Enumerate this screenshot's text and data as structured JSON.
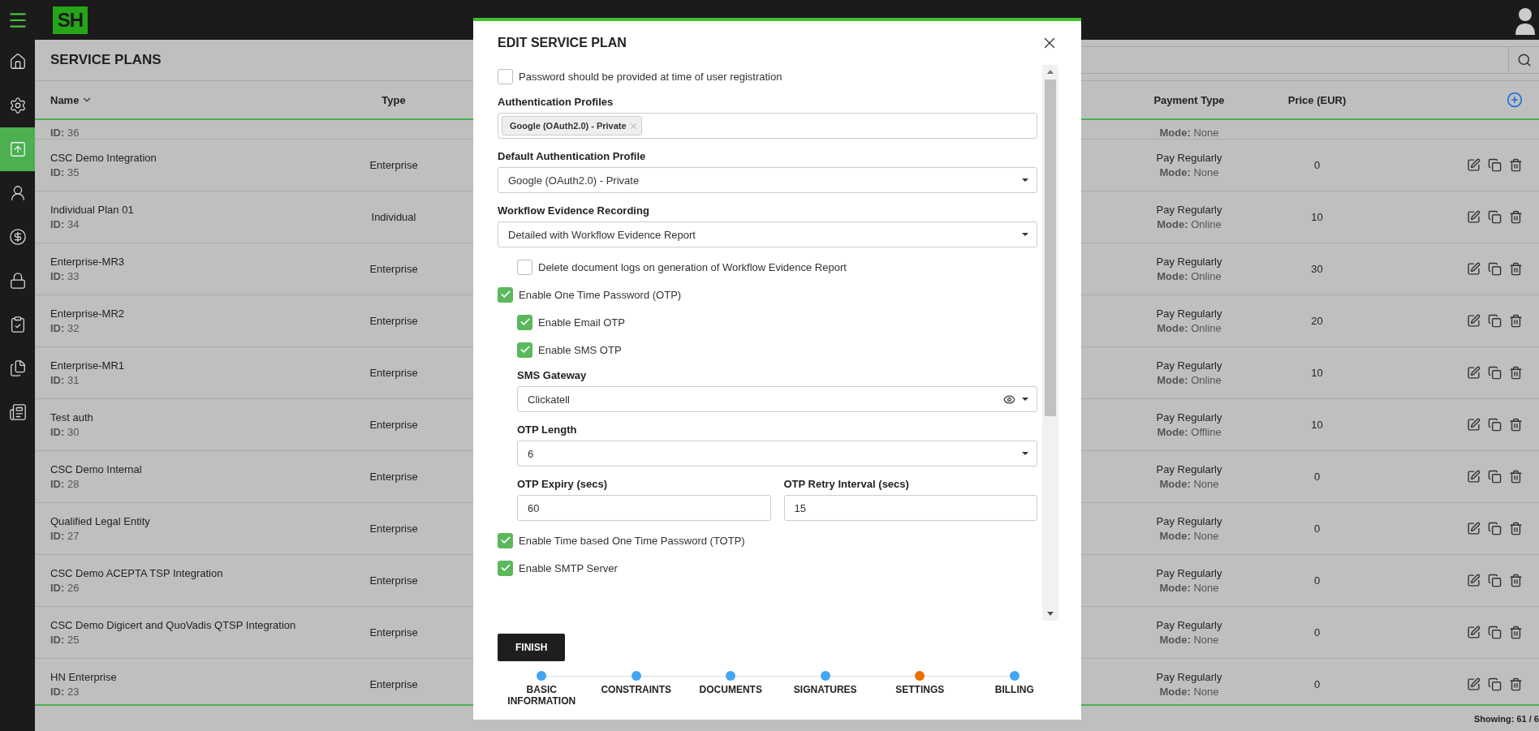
{
  "topbar": {
    "logo": "SH"
  },
  "sidebar": {
    "items": [
      {
        "selected": false
      },
      {
        "selected": false
      },
      {
        "selected": true
      },
      {
        "selected": false
      },
      {
        "selected": false
      },
      {
        "selected": false
      },
      {
        "selected": false
      },
      {
        "selected": false
      },
      {
        "selected": false
      }
    ]
  },
  "page": {
    "title": "SERVICE PLANS"
  },
  "table": {
    "columns": [
      {
        "label": "Name",
        "sorted": true
      },
      {
        "label": "Type",
        "sorted": false
      },
      {
        "label": "Payment Type",
        "sorted": false
      },
      {
        "label": "Price (EUR)",
        "sorted": false
      }
    ],
    "rows": [
      {
        "kind": "partial",
        "id_label": "ID:",
        "id": "36",
        "mode_label": "Mode:",
        "mode": "None"
      },
      {
        "kind": "full",
        "name": "CSC Demo Integration",
        "id_label": "ID:",
        "id": "35",
        "mode_label": "Mode:",
        "type": "Enterprise",
        "payment": "Pay Regularly",
        "mode": "None",
        "price": "0"
      },
      {
        "kind": "full",
        "name": "Individual Plan 01",
        "id_label": "ID:",
        "id": "34",
        "mode_label": "Mode:",
        "type": "Individual",
        "payment": "Pay Regularly",
        "mode": "Online",
        "price": "10"
      },
      {
        "kind": "full",
        "name": "Enterprise-MR3",
        "id_label": "ID:",
        "id": "33",
        "mode_label": "Mode:",
        "type": "Enterprise",
        "payment": "Pay Regularly",
        "mode": "Online",
        "price": "30"
      },
      {
        "kind": "full",
        "name": "Enterprise-MR2",
        "id_label": "ID:",
        "id": "32",
        "mode_label": "Mode:",
        "type": "Enterprise",
        "payment": "Pay Regularly",
        "mode": "Online",
        "price": "20"
      },
      {
        "kind": "full",
        "name": "Enterprise-MR1",
        "id_label": "ID:",
        "id": "31",
        "mode_label": "Mode:",
        "type": "Enterprise",
        "payment": "Pay Regularly",
        "mode": "Online",
        "price": "10"
      },
      {
        "kind": "full",
        "name": "Test auth",
        "id_label": "ID:",
        "id": "30",
        "mode_label": "Mode:",
        "type": "Enterprise",
        "payment": "Pay Regularly",
        "mode": "Offline",
        "price": "10"
      },
      {
        "kind": "full",
        "name": "CSC Demo Internal",
        "id_label": "ID:",
        "id": "28",
        "mode_label": "Mode:",
        "type": "Enterprise",
        "payment": "Pay Regularly",
        "mode": "None",
        "price": "0"
      },
      {
        "kind": "full",
        "name": "Qualified Legal Entity",
        "id_label": "ID:",
        "id": "27",
        "mode_label": "Mode:",
        "type": "Enterprise",
        "payment": "Pay Regularly",
        "mode": "None",
        "price": "0"
      },
      {
        "kind": "full",
        "name": "CSC Demo ACEPTA TSP Integration",
        "id_label": "ID:",
        "id": "26",
        "mode_label": "Mode:",
        "type": "Enterprise",
        "payment": "Pay Regularly",
        "mode": "None",
        "price": "0"
      },
      {
        "kind": "full",
        "name": "CSC Demo Digicert and QuoVadis QTSP Integration",
        "id_label": "ID:",
        "id": "25",
        "mode_label": "Mode:",
        "type": "Enterprise",
        "payment": "Pay Regularly",
        "mode": "None",
        "price": "0"
      },
      {
        "kind": "full",
        "name": "HN Enterprise",
        "id_label": "ID:",
        "id": "23",
        "mode_label": "Mode:",
        "type": "Enterprise",
        "payment": "Pay Regularly",
        "mode": "None",
        "price": "0"
      }
    ]
  },
  "footer": {
    "showing": "Showing: 61 / 6"
  },
  "modal": {
    "title": "EDIT SERVICE PLAN",
    "form": [
      {
        "kind": "checkbox",
        "label": "Password should be provided at time of user registration",
        "checked": false
      },
      {
        "kind": "multiselect",
        "label": "Authentication Profiles",
        "chips": [
          "Google (OAuth2.0) - Private"
        ]
      },
      {
        "kind": "select",
        "label": "Default Authentication Profile",
        "value": "Google (OAuth2.0) - Private"
      },
      {
        "kind": "select",
        "label": "Workflow Evidence Recording",
        "value": "Detailed with Workflow Evidence Report",
        "children": [
          {
            "kind": "checkbox",
            "label": "Delete document logs on generation of Workflow Evidence Report",
            "checked": false
          }
        ]
      },
      {
        "kind": "checkbox",
        "label": "Enable One Time Password (OTP)",
        "checked": true,
        "children": [
          {
            "kind": "checkbox",
            "label": "Enable Email OTP",
            "checked": true
          },
          {
            "kind": "checkbox",
            "label": "Enable SMS OTP",
            "checked": true
          },
          {
            "kind": "select",
            "label": "SMS Gateway",
            "value": "Clickatell",
            "reveal": true
          },
          {
            "kind": "select",
            "label": "OTP Length",
            "value": "6"
          },
          {
            "kind": "pair",
            "fields": [
              {
                "label": "OTP Expiry (secs)",
                "value": "60"
              },
              {
                "label": "OTP Retry Interval (secs)",
                "value": "15"
              }
            ]
          }
        ]
      },
      {
        "kind": "checkbox",
        "label": "Enable Time based One Time Password (TOTP)",
        "checked": true
      },
      {
        "kind": "checkbox",
        "label": "Enable SMTP Server",
        "checked": true
      }
    ],
    "finish": "FINISH",
    "steps": [
      {
        "label": "BASIC INFORMATION",
        "selected": false
      },
      {
        "label": "CONSTRAINTS",
        "selected": false
      },
      {
        "label": "DOCUMENTS",
        "selected": false
      },
      {
        "label": "SIGNATURES",
        "selected": false
      },
      {
        "label": "SETTINGS",
        "selected": true
      },
      {
        "label": "BILLING",
        "selected": false
      }
    ]
  }
}
